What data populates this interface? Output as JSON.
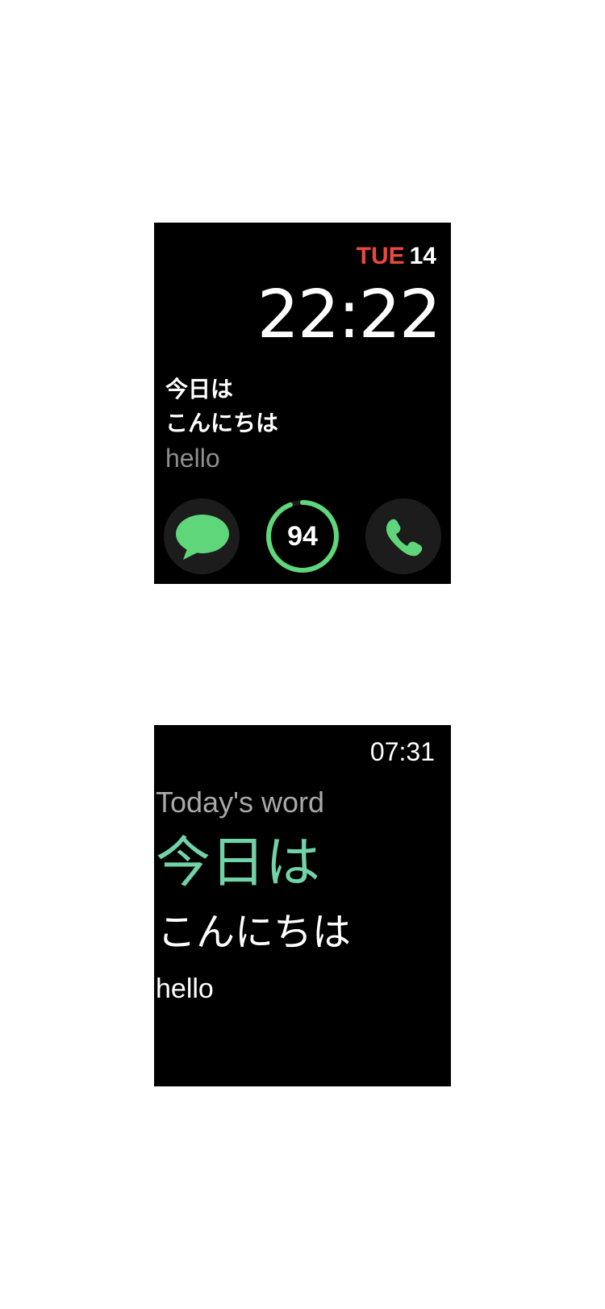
{
  "watch_face": {
    "date": {
      "weekday": "TUE",
      "day": "14"
    },
    "time": "22:22",
    "word": {
      "kanji": "今日は",
      "kana": "こんにちは",
      "meaning": "hello"
    },
    "complications": {
      "messages": {
        "icon": "speech-bubble-icon"
      },
      "progress": {
        "value": "94",
        "fraction": 0.94
      },
      "phone": {
        "icon": "phone-icon"
      }
    }
  },
  "word_app": {
    "time": "07:31",
    "label": "Today's word",
    "kanji": "今日は",
    "kana": "こんにちは",
    "meaning": "hello"
  },
  "colors": {
    "background": "#000000",
    "weekday_red": "#e9493b",
    "accent_green": "#5fd67a",
    "complication_bg": "#1c1c1c",
    "meaning_gray": "#8e8e8e",
    "label_gray": "#a8a8a8",
    "kanji_teal": "#72d2a8"
  }
}
